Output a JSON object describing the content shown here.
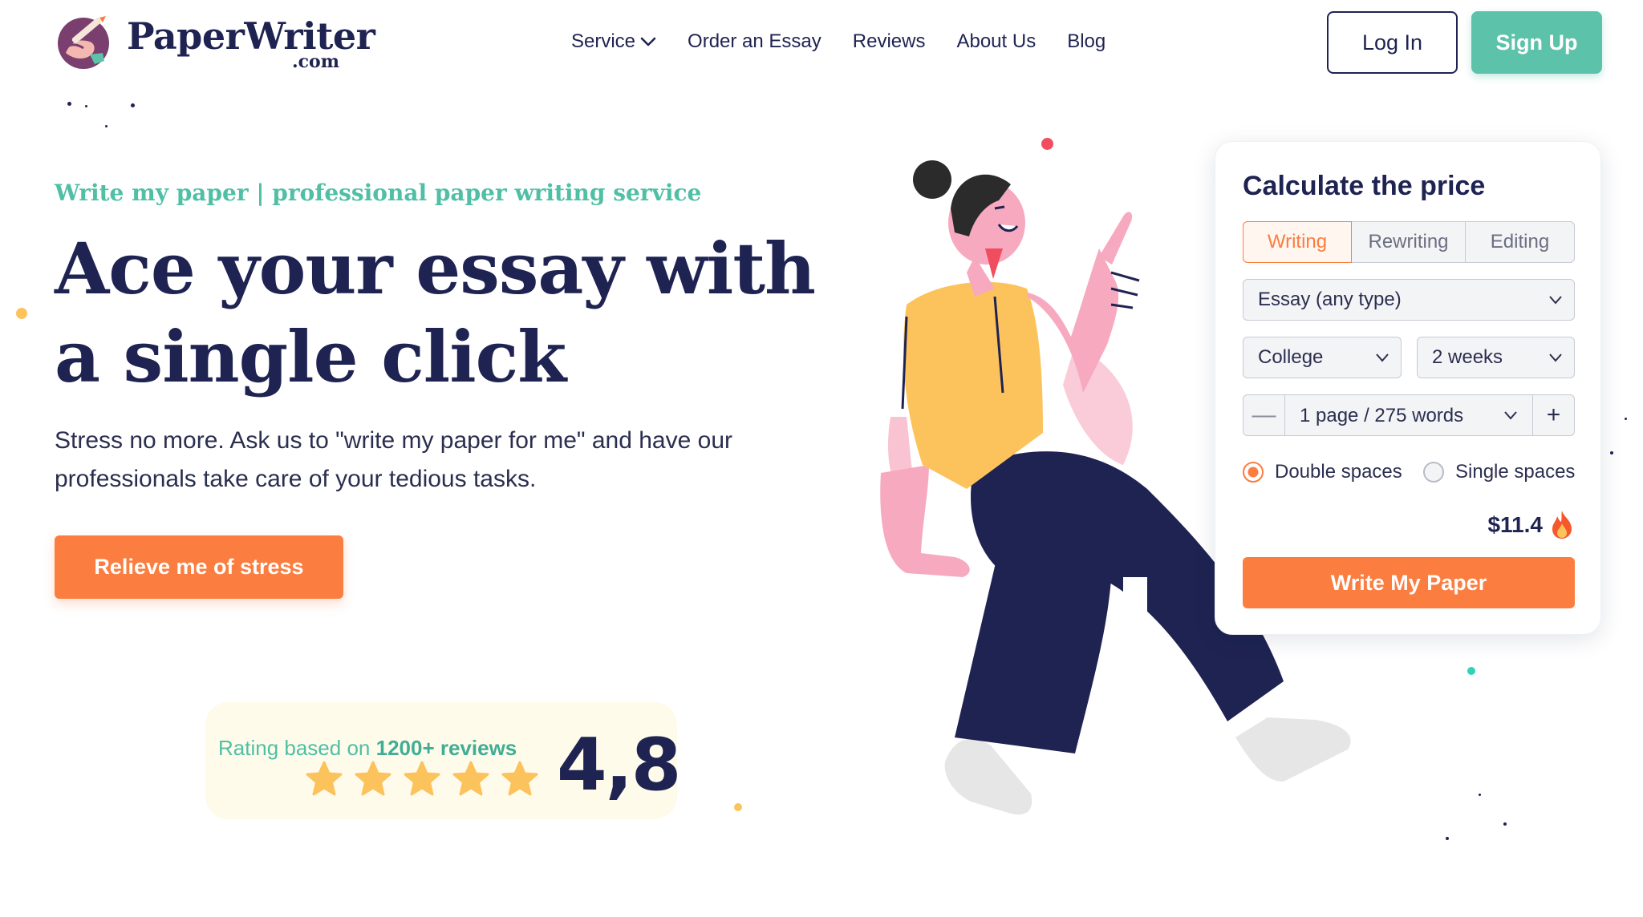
{
  "header": {
    "logo": {
      "name": "PaperWriter",
      "suffix": ".com"
    },
    "nav": [
      {
        "label": "Service",
        "has_dropdown": true
      },
      {
        "label": "Order an Essay"
      },
      {
        "label": "Reviews"
      },
      {
        "label": "About Us"
      },
      {
        "label": "Blog"
      }
    ],
    "login_label": "Log In",
    "signup_label": "Sign Up"
  },
  "hero": {
    "eyebrow": "Write my paper | professional paper writing service",
    "headline_line1": "Ace your essay with",
    "headline_line2": "a single click",
    "subtext": "Stress no more. Ask us to \"write my paper for me\" and have our professionals take care of your tedious tasks.",
    "cta_label": "Relieve me of stress"
  },
  "rating": {
    "prefix": "Rating based on",
    "highlight": "1200+ reviews",
    "stars": 5,
    "score": "4,8"
  },
  "calculator": {
    "title": "Calculate the price",
    "tabs": [
      {
        "label": "Writing",
        "active": true
      },
      {
        "label": "Rewriting",
        "active": false
      },
      {
        "label": "Editing",
        "active": false
      }
    ],
    "paper_type": "Essay (any type)",
    "academic_level": "College",
    "deadline": "2 weeks",
    "pages": "1 page / 275 words",
    "spacing_options": [
      {
        "label": "Double spaces",
        "selected": true
      },
      {
        "label": "Single spaces",
        "selected": false
      }
    ],
    "price": "$11.4",
    "submit_label": "Write My Paper"
  },
  "colors": {
    "navy": "#1e2352",
    "teal": "#5dc2aa",
    "orange": "#fb7d40",
    "yellow": "#fcc35c",
    "pink": "#f7a9bf",
    "rating_bg": "#fffbeb"
  },
  "icons": {
    "logo": "pen-in-hand-logo-icon",
    "service_dropdown": "chevron-down-icon",
    "price_badge": "flame-icon",
    "stepper_minus": "minus-icon",
    "stepper_plus": "plus-icon"
  }
}
